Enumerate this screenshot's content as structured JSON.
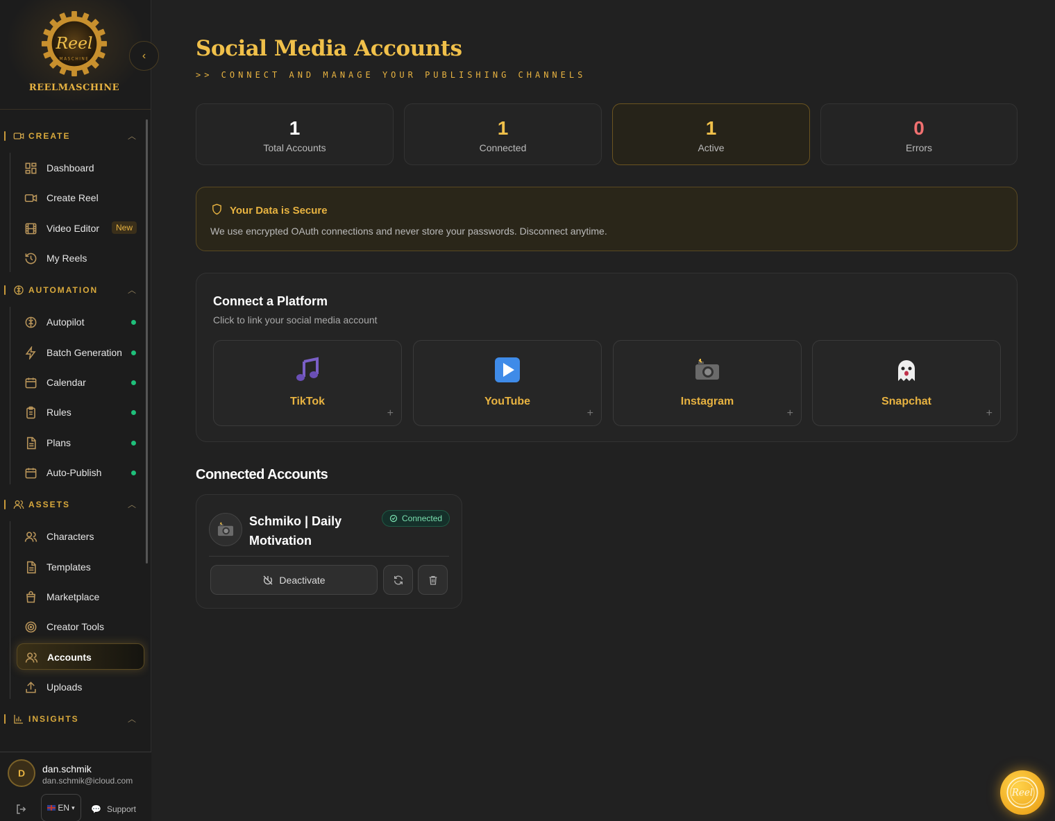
{
  "brand": {
    "name": "REELMASCHINE",
    "logo_text": "Reel",
    "logo_subtext": "MASCHINE"
  },
  "sidebar": {
    "sections": [
      {
        "title": "CREATE",
        "icon": "video-icon",
        "items": [
          {
            "label": "Dashboard",
            "icon": "grid-icon"
          },
          {
            "label": "Create Reel",
            "icon": "video-icon"
          },
          {
            "label": "Video Editor",
            "icon": "film-icon",
            "badge": "New"
          },
          {
            "label": "My Reels",
            "icon": "history-icon"
          }
        ]
      },
      {
        "title": "AUTOMATION",
        "icon": "brain-icon",
        "items": [
          {
            "label": "Autopilot",
            "icon": "brain-icon",
            "status": "active"
          },
          {
            "label": "Batch Generation",
            "icon": "lightning-icon",
            "status": "active"
          },
          {
            "label": "Calendar",
            "icon": "calendar-icon",
            "status": "active"
          },
          {
            "label": "Rules",
            "icon": "clipboard-icon",
            "status": "active"
          },
          {
            "label": "Plans",
            "icon": "document-icon",
            "status": "active"
          },
          {
            "label": "Auto-Publish",
            "icon": "calendar-icon",
            "status": "active"
          }
        ]
      },
      {
        "title": "ASSETS",
        "icon": "users-icon",
        "items": [
          {
            "label": "Characters",
            "icon": "users-icon"
          },
          {
            "label": "Templates",
            "icon": "document-icon"
          },
          {
            "label": "Marketplace",
            "icon": "bag-icon"
          },
          {
            "label": "Creator Tools",
            "icon": "target-icon"
          },
          {
            "label": "Accounts",
            "icon": "users-icon",
            "active": true
          },
          {
            "label": "Uploads",
            "icon": "upload-icon"
          }
        ]
      },
      {
        "title": "INSIGHTS",
        "icon": "chart-icon",
        "items": []
      }
    ]
  },
  "user": {
    "initial": "D",
    "name": "dan.schmik",
    "email": "dan.schmik@icloud.com",
    "language": "EN",
    "support_label": "Support"
  },
  "header": {
    "title": "Social Media Accounts",
    "subtitle": ">> CONNECT AND MANAGE YOUR PUBLISHING CHANNELS"
  },
  "stats": [
    {
      "value": "1",
      "label": "Total Accounts",
      "color": "#ffffff"
    },
    {
      "value": "1",
      "label": "Connected",
      "color": "#f0c04a"
    },
    {
      "value": "1",
      "label": "Active",
      "color": "#f0c04a"
    },
    {
      "value": "0",
      "label": "Errors",
      "color": "#f07070"
    }
  ],
  "secure_notice": {
    "title": "Your Data is Secure",
    "description": "We use encrypted OAuth connections and never store your passwords. Disconnect anytime."
  },
  "connect": {
    "title": "Connect a Platform",
    "subtitle": "Click to link your social media account",
    "platforms": [
      {
        "name": "TikTok",
        "icon": "music-note-icon",
        "glyph": "🎵"
      },
      {
        "name": "YouTube",
        "icon": "play-button-icon",
        "glyph": "▶️"
      },
      {
        "name": "Instagram",
        "icon": "camera-icon",
        "glyph": "📸"
      },
      {
        "name": "Snapchat",
        "icon": "ghost-icon",
        "glyph": "👻"
      }
    ],
    "add_symbol": "+"
  },
  "connected_accounts": {
    "title": "Connected Accounts",
    "accounts": [
      {
        "name": "Schmiko | Daily Motivation",
        "platform_icon": "camera-icon",
        "glyph": "📸",
        "status": "Connected",
        "deactivate_label": "Deactivate"
      }
    ]
  },
  "colors": {
    "accent": "#e8b341",
    "background": "#212121",
    "success": "#1fbf7a",
    "error": "#f07070"
  }
}
